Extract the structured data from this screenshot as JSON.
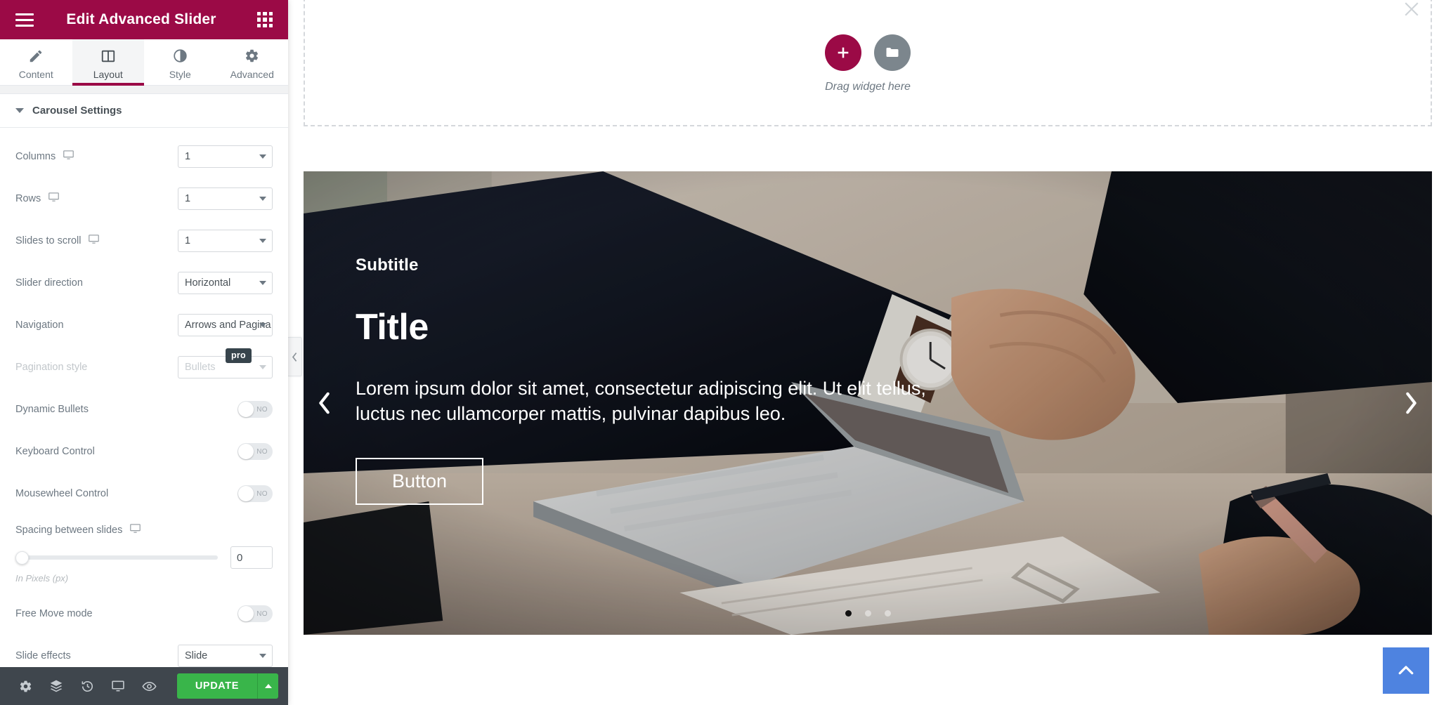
{
  "panel": {
    "header": {
      "title": "Edit Advanced Slider",
      "menu_icon": "hamburger-icon",
      "widgets_icon": "widgets-grid-icon"
    },
    "tabs": [
      {
        "label": "Content",
        "icon": "pencil-icon",
        "active": false
      },
      {
        "label": "Layout",
        "icon": "columns-icon",
        "active": true
      },
      {
        "label": "Style",
        "icon": "contrast-icon",
        "active": false
      },
      {
        "label": "Advanced",
        "icon": "gear-icon",
        "active": false
      }
    ],
    "section": {
      "title": "Carousel Settings",
      "caret": "caret-down-icon"
    },
    "controls": {
      "columns": {
        "label": "Columns",
        "value": "1",
        "device_icon": "desktop-icon"
      },
      "rows": {
        "label": "Rows",
        "value": "1",
        "device_icon": "desktop-icon"
      },
      "slides_to_scroll": {
        "label": "Slides to scroll",
        "value": "1",
        "device_icon": "desktop-icon"
      },
      "slider_direction": {
        "label": "Slider direction",
        "value": "Horizontal"
      },
      "navigation": {
        "label": "Navigation",
        "value": "Arrows and Pagina"
      },
      "pagination_style": {
        "label": "Pagination style",
        "value": "Bullets",
        "badge": "pro",
        "disabled": true
      },
      "dynamic_bullets": {
        "label": "Dynamic Bullets",
        "state": "NO"
      },
      "keyboard_control": {
        "label": "Keyboard Control",
        "state": "NO"
      },
      "mousewheel_control": {
        "label": "Mousewheel Control",
        "state": "NO"
      },
      "spacing": {
        "label": "Spacing between slides",
        "value": "0",
        "hint": "In Pixels (px)",
        "device_icon": "desktop-icon"
      },
      "free_move_mode": {
        "label": "Free Move mode",
        "state": "NO"
      },
      "slide_effects": {
        "label": "Slide effects",
        "value": "Slide"
      }
    },
    "footer": {
      "icons": [
        "settings-gear-icon",
        "navigator-layers-icon",
        "history-icon",
        "responsive-mode-icon",
        "preview-eye-icon"
      ],
      "update_label": "UPDATE",
      "update_caret": "caret-up-icon"
    }
  },
  "canvas": {
    "drop_zone": {
      "add_icon": "plus-icon",
      "template_icon": "folder-icon",
      "label": "Drag widget here"
    },
    "close_icon": "close-x-icon",
    "collapse_handle_icon": "chevron-left-icon",
    "slide": {
      "subtitle": "Subtitle",
      "title": "Title",
      "description": "Lorem ipsum dolor sit amet, consectetur adipiscing elit. Ut elit tellus, luctus nec ullamcorper mattis, pulvinar dapibus leo.",
      "button_label": "Button",
      "prev_icon": "chevron-left-icon",
      "next_icon": "chevron-right-icon",
      "pagination": {
        "count": 3,
        "active_index": 0
      }
    },
    "scroll_top_icon": "chevron-up-icon"
  },
  "colors": {
    "brand": "#9b0a46",
    "update_green": "#39b54a",
    "footer_dark": "#3f464d",
    "scroll_top_blue": "#4e83e0",
    "pro_badge": "#37444c"
  }
}
